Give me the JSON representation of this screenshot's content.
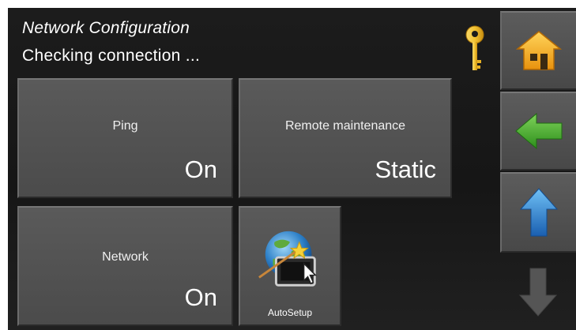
{
  "header": {
    "title": "Network Configuration",
    "status": "Checking connection ..."
  },
  "tiles": {
    "ping": {
      "label": "Ping",
      "value": "On"
    },
    "remote": {
      "label": "Remote maintenance",
      "value": "Static"
    },
    "network": {
      "label": "Network",
      "value": "On"
    },
    "autosetup": {
      "label": "AutoSetup"
    }
  },
  "icons": {
    "key": "key-icon",
    "home": "home-icon",
    "back": "back-arrow-icon",
    "up": "up-arrow-icon",
    "down": "down-arrow-icon",
    "autosetup": "globe-wand-icon"
  },
  "colors": {
    "key": "#f2c232",
    "home": "#f5b21c",
    "back": "#3fae2a",
    "up": "#2a86d4",
    "down_disabled": "#5a5a5a"
  }
}
